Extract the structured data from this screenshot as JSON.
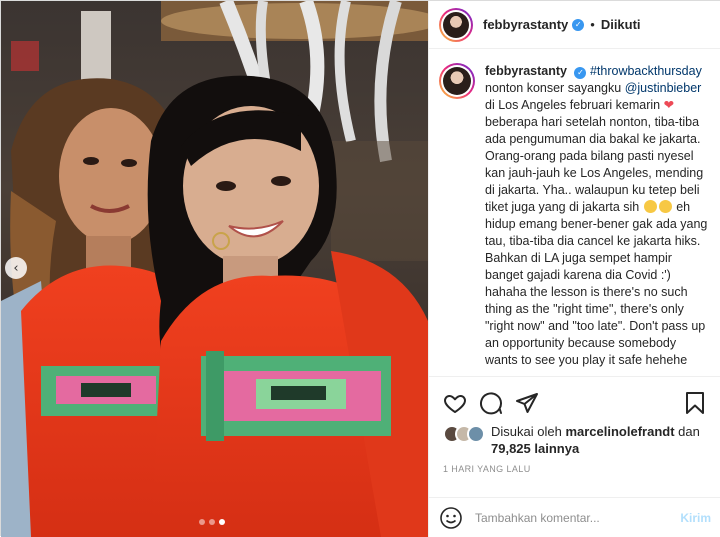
{
  "header": {
    "username": "febbyrastanty",
    "separator": "•",
    "follow_status": "Diikuti"
  },
  "caption": {
    "username": "febbyrastanty",
    "hashtag": "#throwbackthursday",
    "line1": "nonton konser sayangku",
    "mention": "@justinbieber",
    "part2": "di Los Angeles februari kemarin",
    "part3": "beberapa hari setelah nonton, tiba-tiba ada pengumuman dia bakal ke jakarta. Orang-orang pada bilang pasti nyesel kan jauh-jauh ke Los Angeles, mending di jakarta. Yha.. walaupun ku tetep beli tiket juga yang di jakarta sih",
    "part4": "eh hidup emang bener-bener gak ada yang tau, tiba-tiba dia cancel ke jakarta hiks. Bahkan di LA juga sempet hampir banget gajadi karena dia Covid :') hahaha the lesson is there's no such thing as the \"right time\", there's only \"right now\" and \"too late\". Don't pass up an opportunity because somebody wants to see you play it safe hehehe"
  },
  "icons": {
    "heart": "heart-icon",
    "comment": "comment-icon",
    "share": "share-icon",
    "save": "bookmark-icon",
    "verified": "verified-badge-icon",
    "emoji": "smiley-icon",
    "prev": "chevron-left-icon"
  },
  "verified_glyph": "✓",
  "prev_glyph": "‹",
  "likes": {
    "prefix": "Disukai oleh",
    "user": "marcelinolefrandt",
    "connector": "dan",
    "count": "79,825 lainnya"
  },
  "timestamp": "1 HARI YANG LALU",
  "comment_box": {
    "placeholder": "Tambahkan komentar...",
    "post_label": "Kirim"
  },
  "carousel": {
    "slide_count": 3,
    "active_index": 2
  },
  "colors": {
    "accent_blue": "#3897f0",
    "link": "#00376b",
    "heart": "#ed4956",
    "post_disabled": "#b2dffc"
  }
}
